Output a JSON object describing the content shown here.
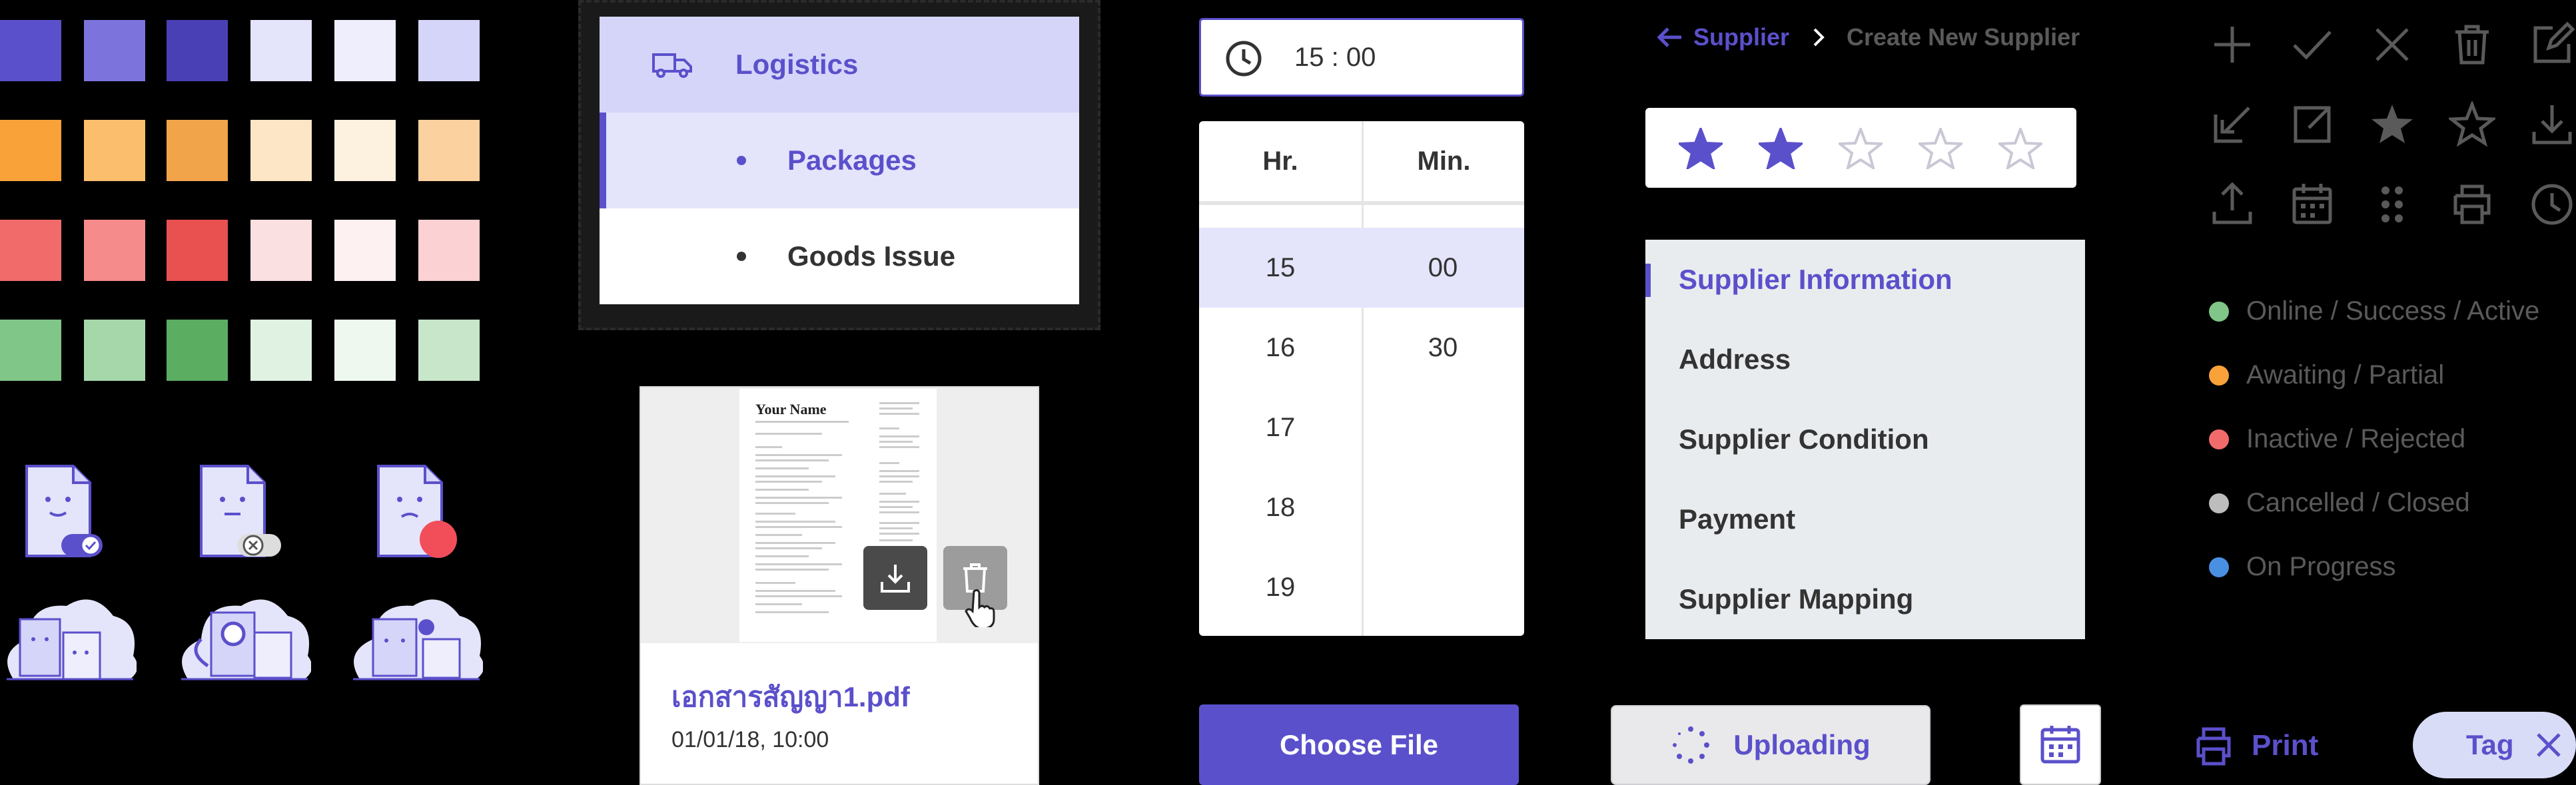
{
  "colors": {
    "accent": "#5b50cb",
    "swatches": [
      [
        "#5b50cb",
        "#7c73dc",
        "#4a40b5",
        "#e4e4fb",
        "#eeeefd",
        "#d5d5fa"
      ],
      [
        "#f9a23a",
        "#fbbe6c",
        "#f2a44a",
        "#fde6c6",
        "#fdf1e0",
        "#fbd1a0"
      ],
      [
        "#f26b6b",
        "#f58b8b",
        "#e95050",
        "#fbe0e2",
        "#fdf1f1",
        "#fbd1d4"
      ],
      [
        "#7fc688",
        "#a6d7ab",
        "#5bad62",
        "#e0f2e2",
        "#eef8ef",
        "#c7e6ca"
      ]
    ]
  },
  "menu": {
    "items": [
      {
        "label": "Logistics",
        "icon": "truck-icon"
      },
      {
        "label": "Packages"
      },
      {
        "label": "Goods Issue"
      }
    ]
  },
  "file_card": {
    "preview_name": "Your Name",
    "file_name": "เอกสารสัญญา1.pdf",
    "timestamp": "01/01/18, 10:00"
  },
  "time_picker": {
    "value": "15 : 00",
    "hour_header": "Hr.",
    "minute_header": "Min.",
    "hours": [
      "15",
      "16",
      "17",
      "18",
      "19"
    ],
    "minutes": [
      "00",
      "30"
    ],
    "selected_hour": "15",
    "selected_minute": "00"
  },
  "breadcrumb": {
    "parent": "Supplier",
    "current": "Create New Supplier"
  },
  "rating": {
    "value": 2,
    "max": 5
  },
  "side_list": {
    "items": [
      "Supplier Information",
      "Address",
      "Supplier Condition",
      "Payment",
      "Supplier Mapping"
    ],
    "active_index": 0
  },
  "icons": [
    [
      "plus-icon",
      "check-icon",
      "close-icon",
      "trash-icon",
      "edit-icon"
    ],
    [
      "import-icon",
      "export-icon",
      "star-filled-icon",
      "star-outline-icon",
      "download-icon"
    ],
    [
      "upload-icon",
      "calendar-icon",
      "drag-handle-icon",
      "print-icon",
      "clock-icon"
    ]
  ],
  "legend": [
    {
      "label": "Online / Success / Active",
      "color": "#7fc688"
    },
    {
      "label": "Awaiting / Partial",
      "color": "#f9a23a"
    },
    {
      "label": "Inactive / Rejected",
      "color": "#f26b6b"
    },
    {
      "label": "Cancelled / Closed",
      "color": "#bdbdbd"
    },
    {
      "label": "On Progress",
      "color": "#4a90e2"
    }
  ],
  "buttons": {
    "choose_file": "Choose File",
    "uploading": "Uploading",
    "print": "Print",
    "tag": "Tag"
  }
}
